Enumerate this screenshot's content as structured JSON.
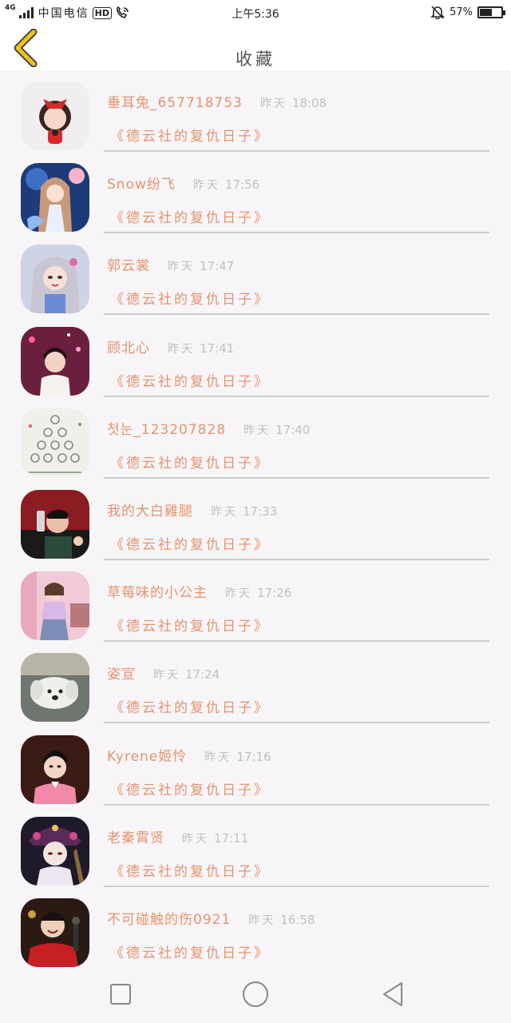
{
  "status_bar": {
    "network": "4G",
    "carrier": "中国电信",
    "hd_badge": "HD",
    "time": "上午5:36",
    "battery": "57%",
    "battery_level": 0.57
  },
  "header": {
    "title": "收藏",
    "back_icon": "chevron-left-icon",
    "accent_color": "#f0c419"
  },
  "colors": {
    "name": "#e3946f",
    "time": "#c2bfc2",
    "divider": "#cfcdcf",
    "background": "#f7f5f7"
  },
  "items": [
    {
      "name": "垂耳兔_657718753",
      "time_label": "昨天",
      "time": "18:08",
      "work": "《德云社的复仇日子》",
      "avatar": "avatar-girl-red-bow"
    },
    {
      "name": "Snow纷飞",
      "time_label": "昨天",
      "time": "17:56",
      "work": "《德云社的复仇日子》",
      "avatar": "avatar-anime-girl-blue"
    },
    {
      "name": "郭云裳",
      "time_label": "昨天",
      "time": "17:47",
      "work": "《德云社的复仇日子》",
      "avatar": "avatar-girl-silver-hair"
    },
    {
      "name": "顾北心",
      "time_label": "昨天",
      "time": "17:41",
      "work": "《德云社的复仇日子》",
      "avatar": "avatar-boy-stage"
    },
    {
      "name": "첫눈_123207828",
      "time_label": "昨天",
      "time": "17:40",
      "work": "《德云社的复仇日子》",
      "avatar": "avatar-sketch-pyramid"
    },
    {
      "name": "我的大白雞腿",
      "time_label": "昨天",
      "time": "17:33",
      "work": "《德云社的复仇日子》",
      "avatar": "avatar-singer-red"
    },
    {
      "name": "草莓味的小公主",
      "time_label": "昨天",
      "time": "17:26",
      "work": "《德云社的复仇日子》",
      "avatar": "avatar-girl-pink-room"
    },
    {
      "name": "姿宣",
      "time_label": "昨天",
      "time": "17:24",
      "work": "《德云社的复仇日子》",
      "avatar": "avatar-white-dog"
    },
    {
      "name": "Kyrene姬怜",
      "time_label": "昨天",
      "time": "17:16",
      "work": "《德云社的复仇日子》",
      "avatar": "avatar-man-pink-shirt"
    },
    {
      "name": "老秦霄贤",
      "time_label": "昨天",
      "time": "17:11",
      "work": "《德云社的复仇日子》",
      "avatar": "avatar-anime-headdress"
    },
    {
      "name": "不可碰触的伤0921",
      "time_label": "昨天",
      "time": "16:58",
      "work": "《德云社的复仇日子》",
      "avatar": "avatar-man-red-robe"
    }
  ],
  "bottom_nav": {
    "recent": "square-icon",
    "home": "circle-icon",
    "back": "triangle-back-icon"
  }
}
